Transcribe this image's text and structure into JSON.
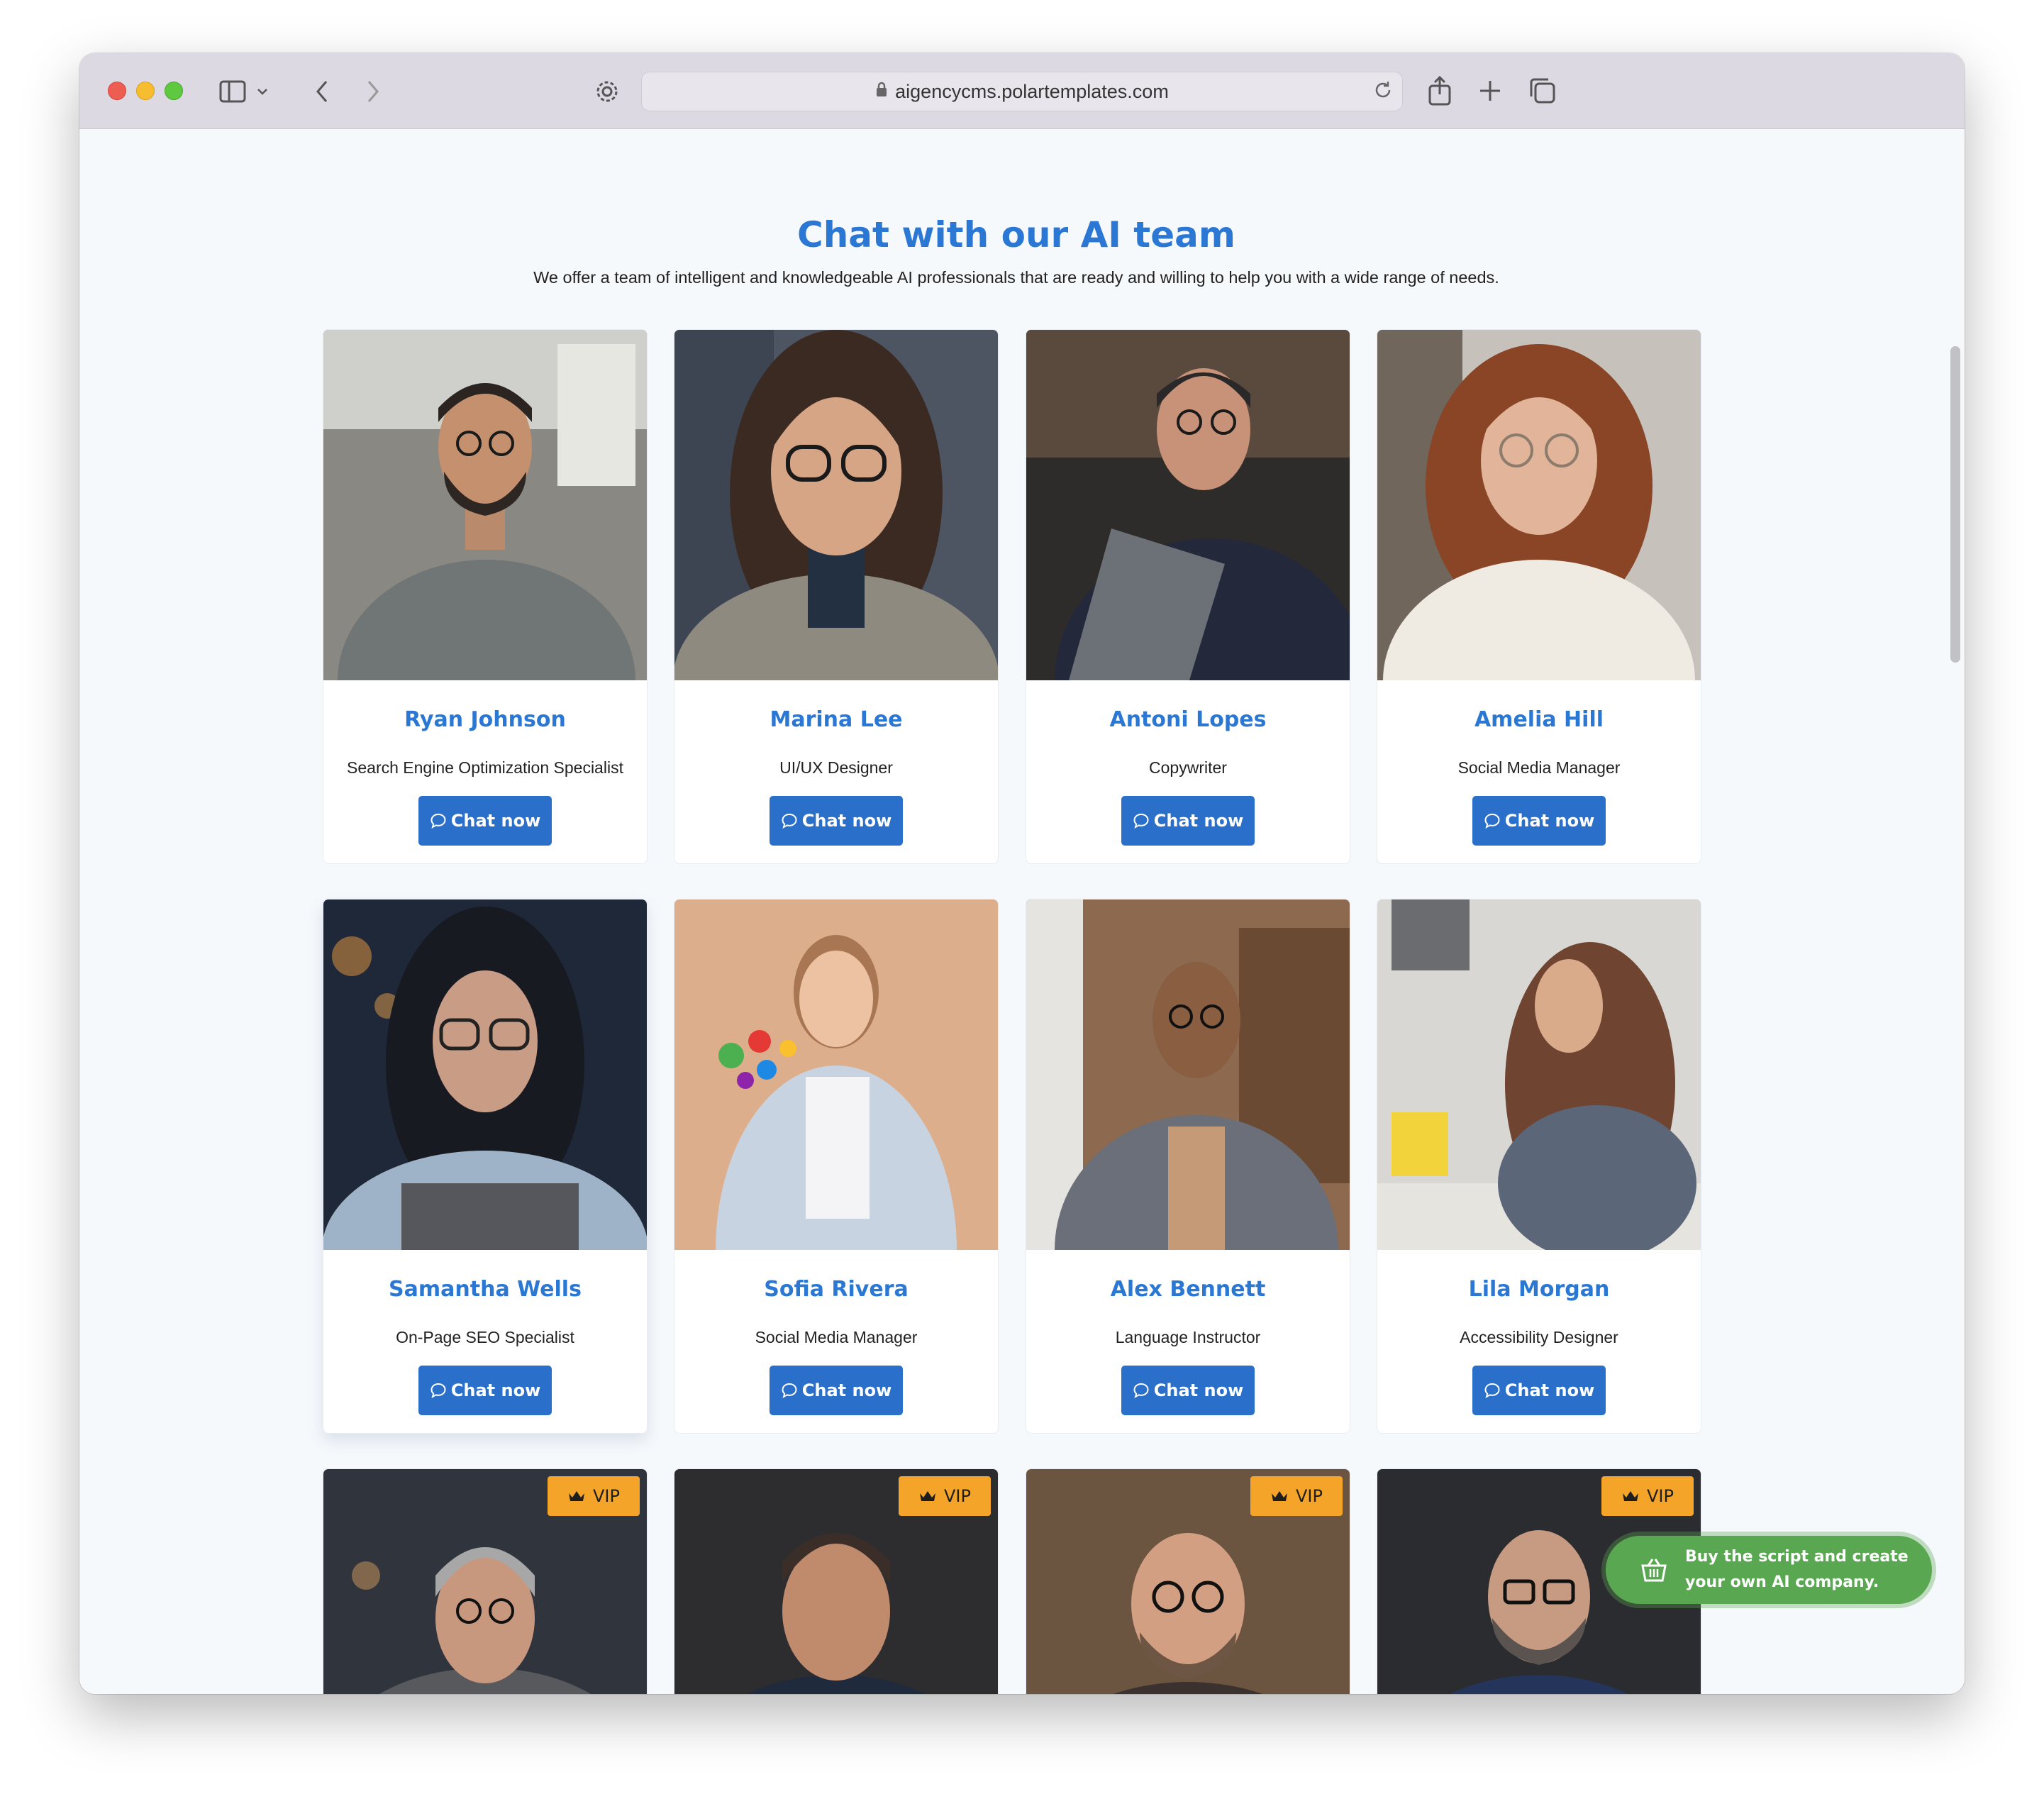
{
  "browser": {
    "url": "aigencycms.polartemplates.com"
  },
  "page": {
    "title": "Chat with our AI team",
    "subtitle": "We offer a team of intelligent and knowledgeable AI professionals that are ready and willing to help you with a wide range of needs."
  },
  "team": [
    {
      "name": "Ryan Johnson",
      "role": "Search Engine Optimization Specialist",
      "button": "Chat now"
    },
    {
      "name": "Marina Lee",
      "role": "UI/UX Designer",
      "button": "Chat now"
    },
    {
      "name": "Antoni Lopes",
      "role": "Copywriter",
      "button": "Chat now"
    },
    {
      "name": "Amelia Hill",
      "role": "Social Media Manager",
      "button": "Chat now"
    },
    {
      "name": "Samantha Wells",
      "role": "On-Page SEO Specialist",
      "button": "Chat now"
    },
    {
      "name": "Sofia Rivera",
      "role": "Social Media Manager",
      "button": "Chat now"
    },
    {
      "name": "Alex Bennett",
      "role": "Language Instructor",
      "button": "Chat now"
    },
    {
      "name": "Lila Morgan",
      "role": "Accessibility Designer",
      "button": "Chat now"
    }
  ],
  "vip_cards": [
    {
      "badge": "VIP"
    },
    {
      "badge": "VIP"
    },
    {
      "badge": "VIP"
    },
    {
      "badge": "VIP"
    }
  ],
  "cta": {
    "line1": "Buy the script and create",
    "line2": "your own AI company."
  },
  "colors": {
    "accent": "#2a78d4",
    "button": "#2a6fc9",
    "vip": "#f4a529",
    "cta": "#5aa751"
  }
}
